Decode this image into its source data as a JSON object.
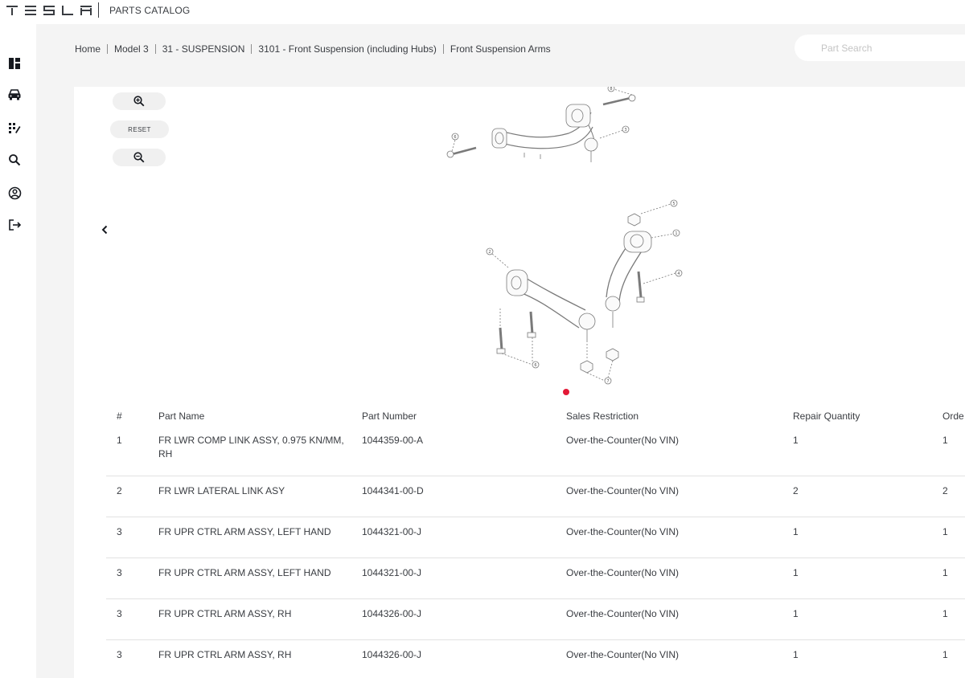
{
  "header": {
    "brand": "TESLA",
    "app_title": "PARTS CATALOG"
  },
  "sidebar": {
    "items": [
      {
        "name": "dashboard-icon"
      },
      {
        "name": "vehicle-icon"
      },
      {
        "name": "catalog-grid-icon"
      },
      {
        "name": "search-icon"
      },
      {
        "name": "account-icon"
      },
      {
        "name": "logout-icon"
      }
    ]
  },
  "breadcrumb": [
    "Home",
    "Model 3",
    "31 - SUSPENSION",
    "3101 - Front Suspension (including Hubs)",
    "Front Suspension Arms"
  ],
  "search": {
    "placeholder": "Part Search"
  },
  "viewer": {
    "reset_label": "RESET",
    "callouts": [
      "8",
      "3",
      "6",
      "5",
      "1",
      "2",
      "4",
      "6",
      "7"
    ],
    "page_dot_color": "#e31937"
  },
  "table": {
    "columns": [
      "#",
      "Part Name",
      "Part Number",
      "Sales Restriction",
      "Repair Quantity",
      "Orde"
    ],
    "rows": [
      {
        "num": "1",
        "name": "FR LWR COMP LINK ASSY, 0.975 KN/MM, RH",
        "part_number": "1044359-00-A",
        "restriction": "Over-the-Counter(No VIN)",
        "repair_qty": "1",
        "order_qty": "1"
      },
      {
        "num": "2",
        "name": "FR LWR LATERAL LINK ASY",
        "part_number": "1044341-00-D",
        "restriction": "Over-the-Counter(No VIN)",
        "repair_qty": "2",
        "order_qty": "2"
      },
      {
        "num": "3",
        "name": "FR UPR CTRL ARM ASSY, LEFT HAND",
        "part_number": "1044321-00-J",
        "restriction": "Over-the-Counter(No VIN)",
        "repair_qty": "1",
        "order_qty": "1"
      },
      {
        "num": "3",
        "name": "FR UPR CTRL ARM ASSY, LEFT HAND",
        "part_number": "1044321-00-J",
        "restriction": "Over-the-Counter(No VIN)",
        "repair_qty": "1",
        "order_qty": "1"
      },
      {
        "num": "3",
        "name": "FR UPR CTRL ARM ASSY, RH",
        "part_number": "1044326-00-J",
        "restriction": "Over-the-Counter(No VIN)",
        "repair_qty": "1",
        "order_qty": "1"
      },
      {
        "num": "3",
        "name": "FR UPR CTRL ARM ASSY, RH",
        "part_number": "1044326-00-J",
        "restriction": "Over-the-Counter(No VIN)",
        "repair_qty": "1",
        "order_qty": "1"
      }
    ]
  }
}
